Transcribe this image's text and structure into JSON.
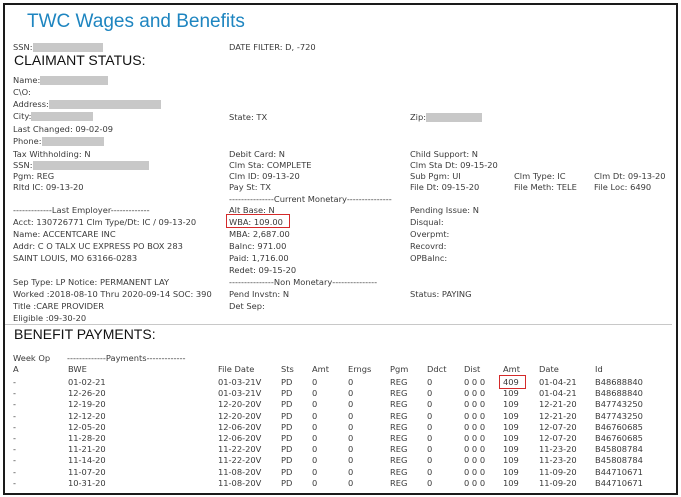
{
  "app": {
    "title": "TWC Wages and Benefits"
  },
  "header": {
    "ssn_label": "SSN:",
    "date_filter": "DATE FILTER: D, -720"
  },
  "claimant": {
    "heading": "CLAIMANT STATUS:",
    "name_label": "Name:",
    "co_label": "C\\O:",
    "address_label": "Address:",
    "city_label": "City:",
    "state": "State: TX",
    "zip_label": "Zip:",
    "last_changed": "Last Changed: 09-02-09",
    "phone_label": "Phone:",
    "tax_withholding": "Tax Withholding: N",
    "debit_card": "Debit Card: N",
    "child_support": "Child Support: N",
    "ssn_label": "SSN:",
    "clm_sta": "Clm Sta: COMPLETE",
    "clm_sta_dt": "Clm Sta Dt: 09-15-20",
    "pgm": "Pgm: REG",
    "clm_id": "Clm ID: 09-13-20",
    "sub_pgm": "Sub Pgm: UI",
    "clm_type": "Clm Type: IC",
    "clm_dt": "Clm Dt: 09-13-20",
    "rltd_ic": "Rltd IC: 09-13-20",
    "pay_st": "Pay St: TX",
    "file_dt": "File Dt: 09-15-20",
    "file_meth": "File Meth: TELE",
    "file_loc": "File Loc: 6490",
    "last_employer_heading": "-------------Last Employer-------------",
    "current_monetary_heading": "---------------Current Monetary---------------",
    "acct": "Acct: 130726771 Clm Type/Dt: IC / 09-13-20",
    "employer_name": "Name: ACCENTCARE INC",
    "addr": "Addr: C O TALX UC EXPRESS PO BOX 283",
    "city_state_zip": "SAINT LOUIS, MO 63166-0283",
    "alt_base": "Alt Base: N",
    "wba": "WBA: 109.00",
    "mba": "MBA: 2,687.00",
    "balnc": "Balnc: 971.00",
    "paid": "Paid: 1,716.00",
    "redet": "Redet: 09-15-20",
    "pending_issue": "Pending Issue: N",
    "disqual": "Disqual:",
    "overpmt": "Overpmt:",
    "recovrd": "Recovrd:",
    "opbalnc": "OPBalnc:",
    "sep_type": "Sep Type: LP Notice: PERMANENT LAY",
    "non_monetary_heading": "---------------Non Monetary---------------",
    "worked": "Worked :2018-08-10 Thru 2020-09-14 SOC: 390",
    "pend_invstn": "Pend Invstn: N",
    "status": "Status: PAYING",
    "title_field": "Title :CARE PROVIDER",
    "det_sep": "Det Sep:",
    "eligible": "Eligible :09-30-20"
  },
  "benefit": {
    "heading": "BENEFIT PAYMENTS:",
    "week_op": "Week Op",
    "payments_heading": "-------------Payments-------------",
    "columns": [
      "A",
      "BWE",
      "File Date",
      "Sts",
      "Amt",
      "Erngs",
      "Pgm",
      "Ddct",
      "Dist",
      "Amt",
      "Date",
      "Id"
    ],
    "rows": [
      [
        "-",
        "01-02-21",
        "01-03-21V",
        "PD",
        "0",
        "0",
        "REG",
        "0",
        "0 0 0",
        "409",
        "01-04-21",
        "B48688840"
      ],
      [
        "-",
        "12-26-20",
        "01-03-21V",
        "PD",
        "0",
        "0",
        "REG",
        "0",
        "0 0 0",
        "109",
        "01-04-21",
        "B48688840"
      ],
      [
        "-",
        "12-19-20",
        "12-20-20V",
        "PD",
        "0",
        "0",
        "REG",
        "0",
        "0 0 0",
        "109",
        "12-21-20",
        "B47743250"
      ],
      [
        "-",
        "12-12-20",
        "12-20-20V",
        "PD",
        "0",
        "0",
        "REG",
        "0",
        "0 0 0",
        "109",
        "12-21-20",
        "B47743250"
      ],
      [
        "-",
        "12-05-20",
        "12-06-20V",
        "PD",
        "0",
        "0",
        "REG",
        "0",
        "0 0 0",
        "109",
        "12-07-20",
        "B46760685"
      ],
      [
        "-",
        "11-28-20",
        "12-06-20V",
        "PD",
        "0",
        "0",
        "REG",
        "0",
        "0 0 0",
        "109",
        "12-07-20",
        "B46760685"
      ],
      [
        "-",
        "11-21-20",
        "11-22-20V",
        "PD",
        "0",
        "0",
        "REG",
        "0",
        "0 0 0",
        "109",
        "11-23-20",
        "B45808784"
      ],
      [
        "-",
        "11-14-20",
        "11-22-20V",
        "PD",
        "0",
        "0",
        "REG",
        "0",
        "0 0 0",
        "109",
        "11-23-20",
        "B45808784"
      ],
      [
        "-",
        "11-07-20",
        "11-08-20V",
        "PD",
        "0",
        "0",
        "REG",
        "0",
        "0 0 0",
        "109",
        "11-09-20",
        "B44710671"
      ],
      [
        "-",
        "10-31-20",
        "11-08-20V",
        "PD",
        "0",
        "0",
        "REG",
        "0",
        "0 0 0",
        "109",
        "11-09-20",
        "B44710671"
      ]
    ]
  },
  "colors": {
    "title": "#1e85c0",
    "highlight": "#d42a2a",
    "redaction": "#c8c8c8"
  }
}
